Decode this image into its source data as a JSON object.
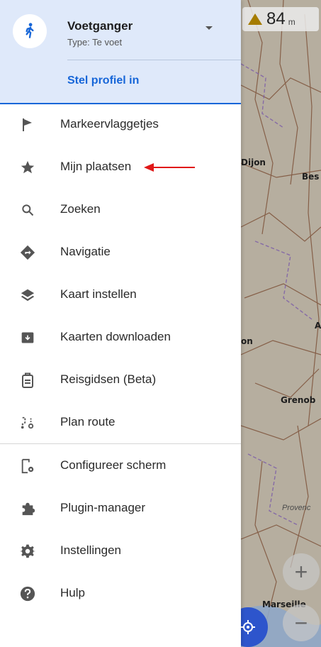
{
  "map": {
    "altitude": {
      "value": "84",
      "unit": "m"
    },
    "cities": [
      "Dijon",
      "Bes",
      "on",
      "A",
      "Grenob",
      "Marseille"
    ],
    "province_label": "Provenc",
    "zoom_in": "+",
    "zoom_out": "−"
  },
  "profile": {
    "name": "Voetganger",
    "type": "Type: Te voet",
    "link": "Stel profiel in"
  },
  "menu": {
    "items": [
      {
        "label": "Markeervlaggetjes",
        "icon": "flag-icon"
      },
      {
        "label": "Mijn plaatsen",
        "icon": "star-icon"
      },
      {
        "label": "Zoeken",
        "icon": "search-icon"
      },
      {
        "label": "Navigatie",
        "icon": "navigation-icon"
      },
      {
        "label": "Kaart instellen",
        "icon": "layers-icon"
      },
      {
        "label": "Kaarten downloaden",
        "icon": "download-icon"
      },
      {
        "label": "Reisgidsen (Beta)",
        "icon": "travel-guide-icon"
      },
      {
        "label": "Plan route",
        "icon": "plan-route-icon"
      },
      {
        "label": "Configureer scherm",
        "icon": "configure-screen-icon"
      },
      {
        "label": "Plugin-manager",
        "icon": "plugin-icon"
      },
      {
        "label": "Instellingen",
        "icon": "settings-icon"
      },
      {
        "label": "Hulp",
        "icon": "help-icon"
      }
    ]
  },
  "colors": {
    "accent": "#1766d8",
    "profile_bg": "#dfe9fa",
    "annotation_arrow": "#e01818"
  }
}
